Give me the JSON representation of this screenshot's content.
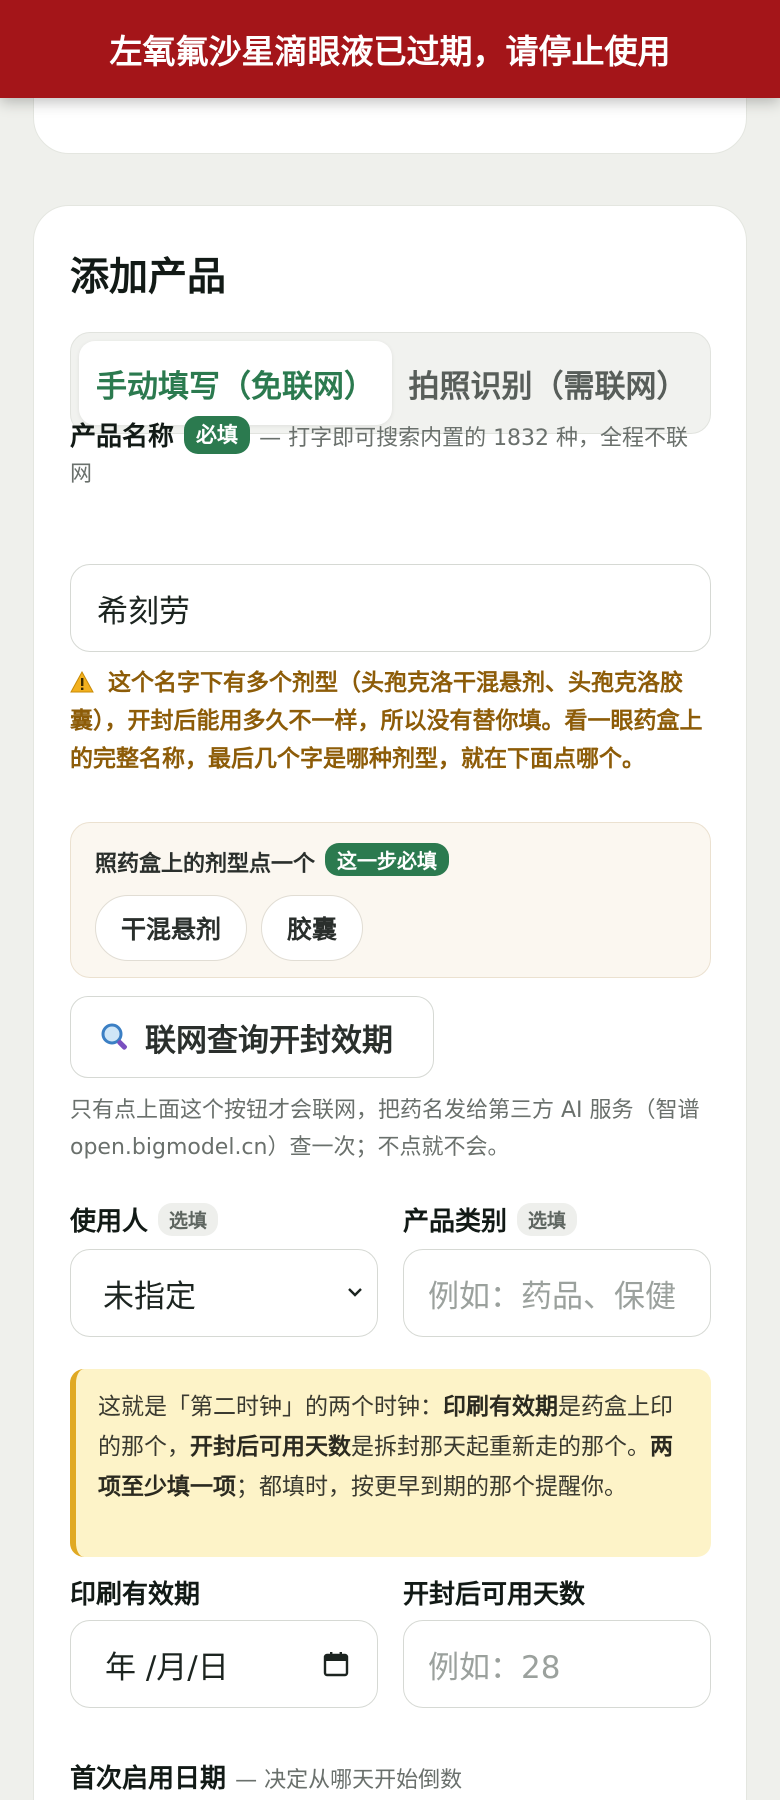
{
  "banner": {
    "text": "左氧氟沙星滴眼液已过期，请停止使用"
  },
  "card": {
    "title": "添加产品",
    "tabs": [
      {
        "label": "手动填写（免联网）"
      },
      {
        "label": "拍照识别（需联网）"
      }
    ]
  },
  "product_name": {
    "label": "产品名称",
    "badge": "必填",
    "hint": "— 打字即可搜索内置的 1832 种，全程不联网",
    "value": "希刻劳"
  },
  "warning": {
    "icon": "warning-triangle-icon",
    "text": "这个名字下有多个剂型（头孢克洛干混悬剂、头孢克洛胶囊），开封后能用多久不一样，所以没有替你填。看一眼药盒上的完整名称，最后几个字是哪种剂型，就在下面点哪个。"
  },
  "dosage_picker": {
    "title": "照药盒上的剂型点一个",
    "badge": "这一步必填",
    "options": [
      "干混悬剂",
      "胶囊"
    ]
  },
  "lookup": {
    "icon": "magnifier-icon",
    "label": "联网查询开封效期",
    "note": "只有点上面这个按钮才会联网，把药名发给第三方 AI 服务（智谱 open.bigmodel.cn）查一次；不点就不会。"
  },
  "user": {
    "label": "使用人",
    "badge": "选填",
    "selected": "未指定"
  },
  "category": {
    "label": "产品类别",
    "badge": "选填",
    "placeholder": "例如：药品、保健"
  },
  "info": {
    "t1": "这就是「第二时钟」的两个时钟：",
    "b1": "印刷有效期",
    "t2": "是药盒上印的那个，",
    "b2": "开封后可用天数",
    "t3": "是拆封那天起重新走的那个。",
    "b3": "两项至少填一项",
    "t4": "；都填时，按更早到期的那个提醒你。"
  },
  "expiry": {
    "label": "印刷有效期",
    "placeholder": "年 /月/日"
  },
  "days_after_open": {
    "label": "开封后可用天数",
    "placeholder": "例如：28"
  },
  "first_use": {
    "label": "首次启用日期",
    "hint": "— 决定从哪天开始倒数"
  },
  "colors": {
    "banner": "#a41519",
    "accent_green": "#2b7a4f",
    "warning_text": "#8d5c08",
    "info_bg": "#fdf3c8",
    "info_border": "#e0a923"
  }
}
